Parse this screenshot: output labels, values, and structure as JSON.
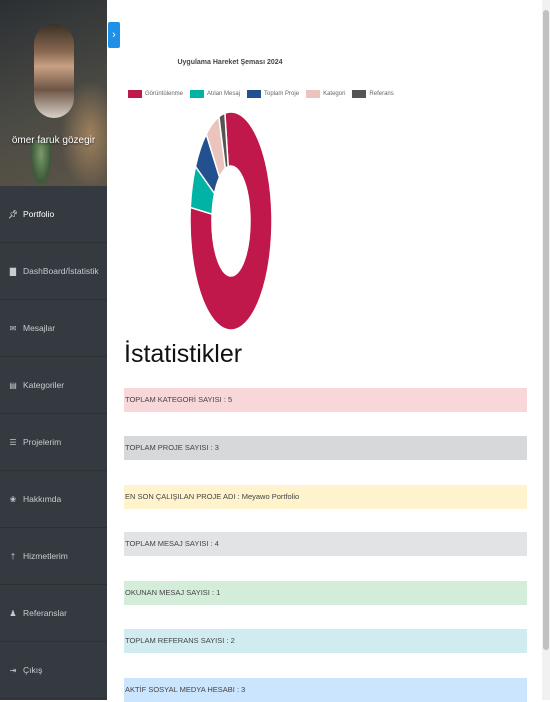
{
  "sidebar": {
    "profile_name": "ömer faruk gözegir",
    "items": [
      {
        "label": "Portfolio",
        "icon": "pin-icon"
      },
      {
        "label": "DashBoard/İstatistik",
        "icon": "bar-chart-icon"
      },
      {
        "label": "Mesajlar",
        "icon": "envelope-icon"
      },
      {
        "label": "Kategoriler",
        "icon": "folder-icon"
      },
      {
        "label": "Projelerim",
        "icon": "list-icon"
      },
      {
        "label": "Hakkımda",
        "icon": "paw-icon"
      },
      {
        "label": "Hizmetlerim",
        "icon": "wrench-icon"
      },
      {
        "label": "Referanslar",
        "icon": "users-icon"
      },
      {
        "label": "Çıkış",
        "icon": "logout-icon"
      }
    ]
  },
  "toggle": {
    "label": "›"
  },
  "chart_data": {
    "type": "pie",
    "title": "Uygulama Hareket Şeması 2024",
    "legend_position": "top",
    "categories": [
      "Görüntülenme",
      "Atılan Mesaj",
      "Toplam Proje",
      "Kategori",
      "Referans"
    ],
    "values": [
      100,
      8,
      8,
      7,
      3
    ],
    "colors": [
      "#c0184a",
      "#00b3a4",
      "#23508f",
      "#ebc4be",
      "#555555"
    ]
  },
  "stats": {
    "title": "İstatistikler",
    "rows": [
      {
        "text": "TOPLAM KATEGORİ SAYISI : 5",
        "bg": "#f8d7da"
      },
      {
        "text": "TOPLAM PROJE SAYISI : 3",
        "bg": "#d6d8d9"
      },
      {
        "text": "EN SON ÇALIŞILAN PROJE ADI : Meyawo Portfolio",
        "bg": "#fff3cd"
      },
      {
        "text": "TOPLAM MESAJ SAYISI : 4",
        "bg": "#e2e3e5"
      },
      {
        "text": "OKUNAN MESAJ SAYISI : 1",
        "bg": "#d4edda"
      },
      {
        "text": "TOPLAM REFERANS SAYISI : 2",
        "bg": "#d1ecf1"
      },
      {
        "text": "AKTİF SOSYAL MEDYA HESABI : 3",
        "bg": "#cce5ff"
      }
    ]
  }
}
